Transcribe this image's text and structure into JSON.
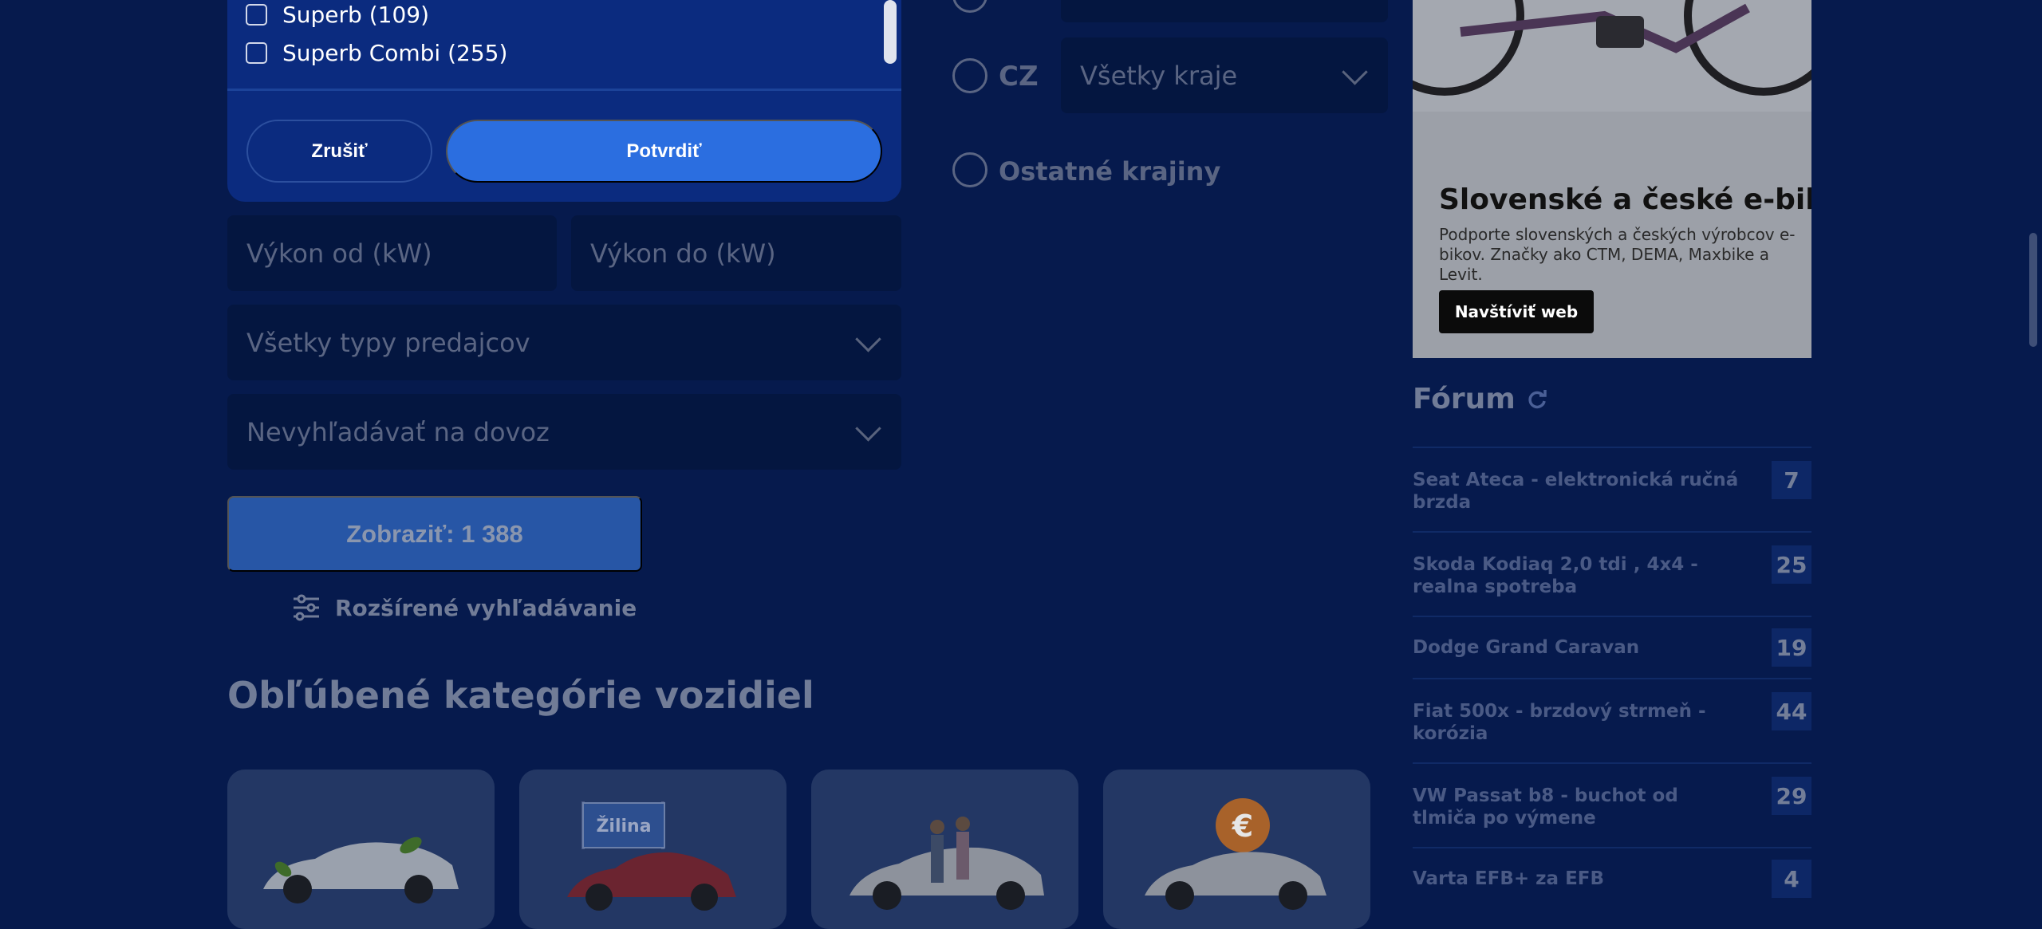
{
  "model_filter": {
    "options": [
      {
        "label": "Superb (109)",
        "checked": false
      },
      {
        "label": "Superb Combi (255)",
        "checked": false
      }
    ],
    "cancel_label": "Zrušiť",
    "confirm_label": "Potvrdiť"
  },
  "power": {
    "from_placeholder": "Výkon od (kW)",
    "to_placeholder": "Výkon do (kW)"
  },
  "seller_type": {
    "selected": "Všetky typy predajcov"
  },
  "import_filter": {
    "selected": "Nevyhľadávať na dovoz"
  },
  "show_button_label": "Zobraziť: 1 388",
  "advanced_search_label": "Rozšírené vyhľadávanie",
  "location": {
    "cz_label": "CZ",
    "cz_region_selected": "Všetky kraje",
    "other_label": "Ostatné krajiny"
  },
  "categories": {
    "title": "Obľúbené kategórie vozidiel",
    "cards": [
      {
        "icon": "eco-car"
      },
      {
        "icon": "zilina-car",
        "sign_text": "Žilina"
      },
      {
        "icon": "family-car"
      },
      {
        "icon": "cheap-car",
        "badge": "€"
      }
    ]
  },
  "ad": {
    "title": "Slovenské a české e-bike",
    "text": "Podporte slovenských a českých výrobcov e-bikov. Značky ako CTM, DEMA, Maxbike a Levit.",
    "button_label": "Navštíviť web"
  },
  "forum": {
    "title": "Fórum",
    "items": [
      {
        "title": "Seat Ateca - elektronická ručná brzda",
        "count": "7"
      },
      {
        "title": "Skoda Kodiaq 2,0 tdi , 4x4 - realna spotreba",
        "count": "25"
      },
      {
        "title": "Dodge Grand Caravan",
        "count": "19"
      },
      {
        "title": "Fiat 500x - brzdový strmeň - korózia",
        "count": "44"
      },
      {
        "title": "VW Passat b8 - buchot od tlmiča po výmene",
        "count": "29"
      },
      {
        "title": "Varta EFB+ za EFB",
        "count": "4"
      }
    ]
  },
  "colors": {
    "background": "#061a4d",
    "panel": "#0b2b7f",
    "primary": "#2b6ee0"
  }
}
